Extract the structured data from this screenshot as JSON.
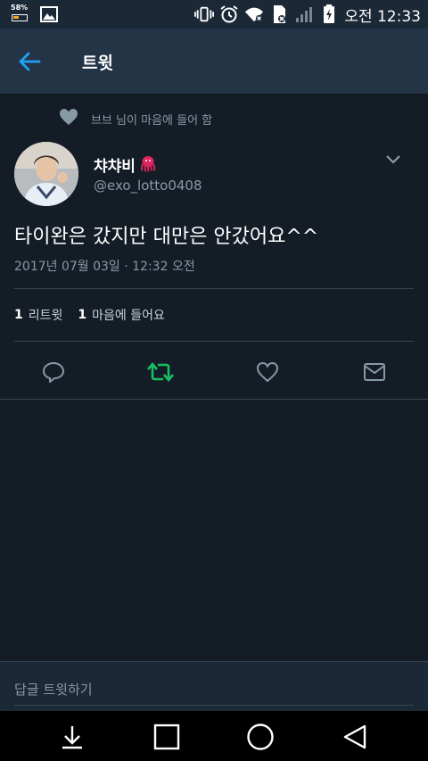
{
  "status_bar": {
    "battery_percent_label": "58%",
    "clock": "오전 12:33",
    "icons": [
      "battery-icon",
      "gallery-icon",
      "vibrate-icon",
      "alarm-icon",
      "wifi-icon",
      "sim-icon",
      "signal-icon",
      "battery-charging-icon"
    ]
  },
  "app_bar": {
    "title": "트윗",
    "back_icon": "arrow-left-icon"
  },
  "tweet": {
    "social_context": "브브 님이 마음에 들어 함",
    "display_name": "챠챠비",
    "name_emoji": "octopus-icon",
    "handle": "@exo_lotto0408",
    "text": "타이완은 갔지만 대만은 안갔어요^^",
    "timestamp": "2017년 07월 03일 · 12:32 오전",
    "stats": {
      "retweets_count": "1",
      "retweets_label": "리트윗",
      "likes_count": "1",
      "likes_label": "마음에 들어요"
    },
    "actions": [
      "reply-icon",
      "retweet-icon",
      "like-icon",
      "dm-icon"
    ]
  },
  "reply_bar": {
    "placeholder": "답글 트윗하기"
  },
  "nav_bar": {
    "buttons": [
      "download-icon",
      "recent-apps-icon",
      "home-icon",
      "back-icon"
    ]
  },
  "colors": {
    "background": "#141d26",
    "app_bar": "#243447",
    "accent_blue": "#1da1f2",
    "retweet_green": "#17bf63",
    "secondary_text": "#8899a6",
    "divider": "#38444d"
  }
}
